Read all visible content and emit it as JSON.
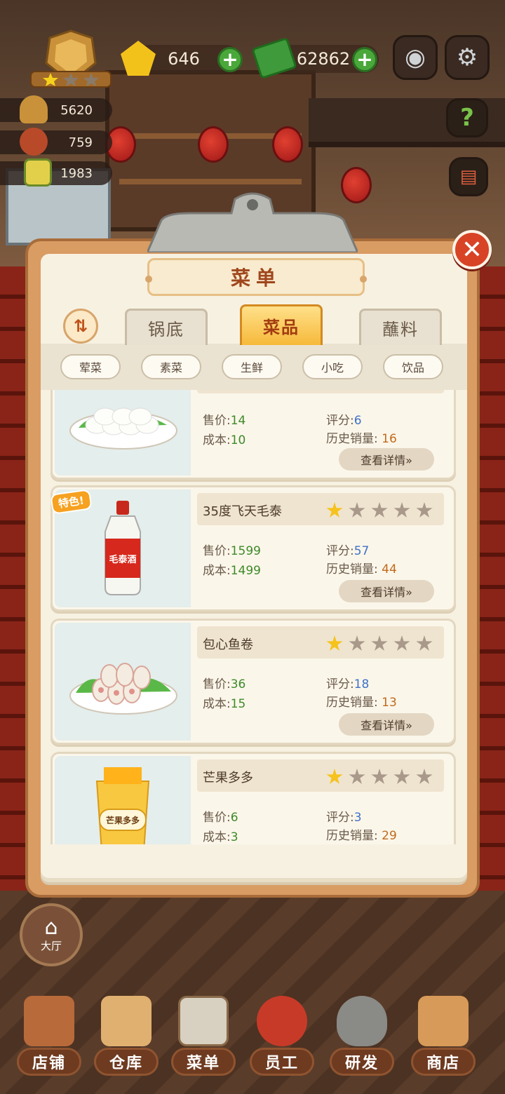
{
  "hud": {
    "gems": "646",
    "cash": "62862",
    "stat_food": "5620",
    "stat_chef": "759",
    "stat_book": "1983",
    "badge_stars": 1
  },
  "panel": {
    "title": "菜单",
    "tabs": [
      {
        "label": "锅底",
        "active": false
      },
      {
        "label": "菜品",
        "active": true
      },
      {
        "label": "蘸料",
        "active": false
      }
    ],
    "chips": [
      "荤菜",
      "素菜",
      "生鲜",
      "小吃",
      "饮品"
    ],
    "price_label": "售价",
    "cost_label": "成本",
    "score_label": "评分",
    "sales_label": "历史销量",
    "detail_label": "查看详情»",
    "special_label": "特色!"
  },
  "dishes": [
    {
      "name": "",
      "price": "14",
      "cost": "10",
      "score": "6",
      "sales": "16",
      "stars": 1,
      "special": false,
      "icon": "rice-cake-plate-icon"
    },
    {
      "name": "35度飞天毛泰",
      "price": "1599",
      "cost": "1499",
      "score": "57",
      "sales": "44",
      "stars": 1,
      "special": true,
      "icon": "liquor-bottle-icon",
      "icon_text": "毛泰酒"
    },
    {
      "name": "包心鱼卷",
      "price": "36",
      "cost": "15",
      "score": "18",
      "sales": "13",
      "stars": 1,
      "special": false,
      "icon": "fish-roll-plate-icon"
    },
    {
      "name": "芒果多多",
      "price": "6",
      "cost": "3",
      "score": "3",
      "sales": "29",
      "stars": 1,
      "special": false,
      "icon": "mango-drink-icon",
      "icon_text": "芒果多多"
    }
  ],
  "hall_label": "大厅",
  "nav": [
    "店铺",
    "仓库",
    "菜单",
    "员工",
    "研发",
    "商店"
  ],
  "colors": {
    "accent": "#f6b93a",
    "close": "#d84326",
    "green_value": "#3e8a2a",
    "blue_value": "#3f72c8",
    "orange_value": "#c26a1c"
  }
}
